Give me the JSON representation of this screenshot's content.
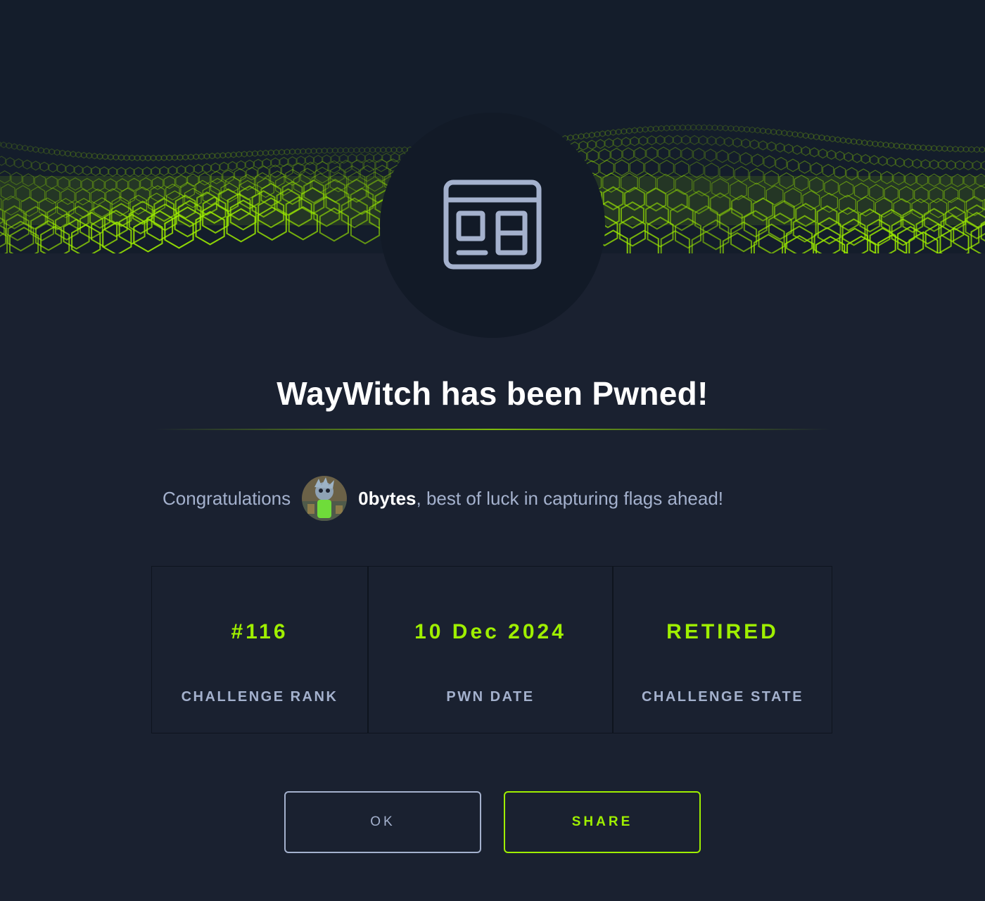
{
  "header": {
    "banner": "green-hex-wave-banner",
    "icon": "web-layout-icon"
  },
  "title": "WayWitch has been Pwned!",
  "congrats": {
    "prefix": "Congratulations",
    "username": "0bytes",
    "suffix": ", best of luck in capturing flags ahead!",
    "avatar": "user-avatar"
  },
  "stats": [
    {
      "value": "#116",
      "label": "CHALLENGE RANK"
    },
    {
      "value": "10 Dec 2024",
      "label": "PWN DATE"
    },
    {
      "value": "RETIRED",
      "label": "CHALLENGE STATE"
    }
  ],
  "buttons": {
    "ok": "OK",
    "share": "SHARE"
  },
  "colors": {
    "accent": "#9fef00",
    "background": "#1a2130",
    "banner": "#141d2b",
    "muted_text": "#a4b1cd"
  }
}
